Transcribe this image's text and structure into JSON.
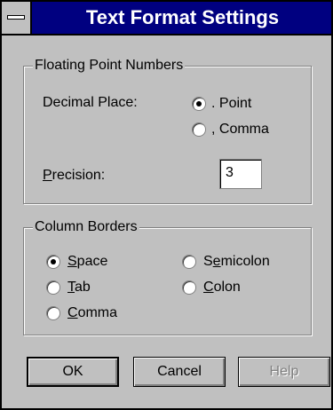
{
  "window": {
    "title": "Text Format Settings"
  },
  "floating": {
    "label": "Floating Point Numbers",
    "decimal_label": "Decimal Place:",
    "options": [
      {
        "label": ". Point",
        "selected": true
      },
      {
        "label": ", Comma",
        "selected": false
      }
    ],
    "precision_label": "Precision:",
    "precision_value": "3"
  },
  "borders": {
    "label": "Column Borders",
    "options": [
      {
        "label": "Space",
        "selected": true
      },
      {
        "label": "Semicolon",
        "selected": false
      },
      {
        "label": "Tab",
        "selected": false
      },
      {
        "label": "Colon",
        "selected": false
      },
      {
        "label": "Comma",
        "selected": false
      }
    ]
  },
  "buttons": {
    "ok": "OK",
    "cancel": "Cancel",
    "help": "Help"
  }
}
